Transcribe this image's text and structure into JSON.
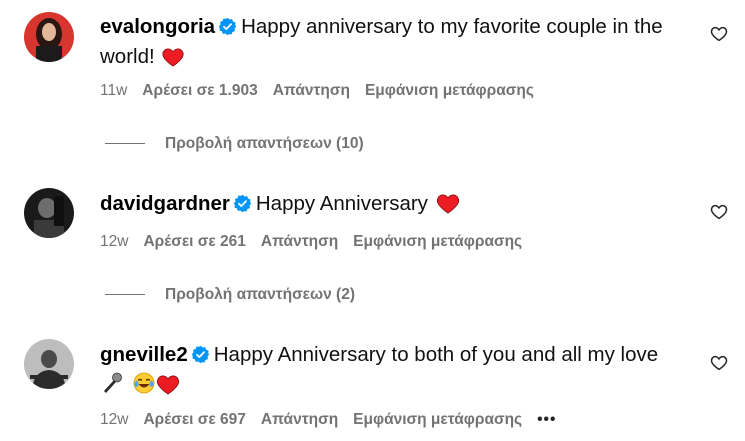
{
  "comments": [
    {
      "username": "evalongoria",
      "text": "Happy anniversary to my favorite couple in the world!",
      "emojis": [
        "red-heart"
      ],
      "time": "11w",
      "likes": "Αρέσει σε 1.903",
      "reply": "Απάντηση",
      "translate": "Εμφάνιση μετάφρασης",
      "view_replies": "Προβολή απαντήσεων (10)"
    },
    {
      "username": "davidgardner",
      "text": "Happy Anniversary",
      "emojis": [
        "red-heart"
      ],
      "time": "12w",
      "likes": "Αρέσει σε 261",
      "reply": "Απάντηση",
      "translate": "Εμφάνιση μετάφρασης",
      "view_replies": "Προβολή απαντήσεων (2)"
    },
    {
      "username": "gneville2",
      "text": "Happy Anniversary to both of you and all my love",
      "emojis": [
        "microphone",
        "tears-of-joy",
        "red-heart"
      ],
      "time": "12w",
      "likes": "Αρέσει σε 697",
      "reply": "Απάντηση",
      "translate": "Εμφάνιση μετάφρασης",
      "more": "•••"
    }
  ],
  "colors": {
    "verified": "#0095f6",
    "heart": "#ed1c24",
    "meta": "#737373"
  }
}
